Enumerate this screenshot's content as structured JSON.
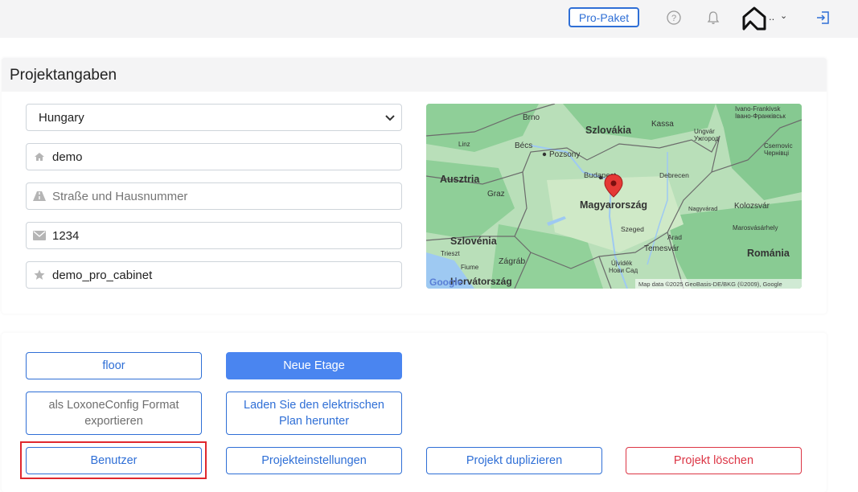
{
  "topbar": {
    "pro_label": "Pro-Paket",
    "user_dots": "..",
    "icons": [
      "help-icon",
      "bell-icon",
      "home-logo-icon",
      "chevron-down-icon",
      "logout-icon"
    ]
  },
  "project": {
    "title": "Projektangaben",
    "country": "Hungary",
    "name_value": "demo",
    "street_placeholder": "Straße und Hausnummer",
    "zip_value": "1234",
    "cabinet_value": "demo_pro_cabinet"
  },
  "map": {
    "labels": {
      "brno": "Brno",
      "slovakia": "Szlovákia",
      "kassa": "Kassa",
      "ungvar": "Ungvár",
      "uzhhorod": "Ужгород",
      "ivano": "Ivano-Frankivsk",
      "ivano_cyr": "Івано-Франківськ",
      "linz": "Linz",
      "becs": "Bécs",
      "pozsony": "Pozsony",
      "csernovic": "Csernovic",
      "chernivtsi": "Чернівці",
      "austria": "Ausztria",
      "budapest": "Budapest",
      "debrecen": "Debrecen",
      "graz": "Graz",
      "hungary": "Magyarország",
      "nagyvarad": "Nagyvárad",
      "kolozsvar": "Kolozsvár",
      "szeged": "Szeged",
      "arad": "Arad",
      "marosvasarhely": "Marosvásárhely",
      "slovenia": "Szlovénia",
      "temesvar": "Temesvár",
      "trieszt": "Trieszt",
      "zagrab": "Zágráb",
      "romania": "Románia",
      "fiume": "Fiume",
      "ujvidek": "Újvidék",
      "novi_sad": "Нови Сад",
      "croatia": "Horvátország",
      "google": "Google",
      "attribution": "Map data ©2025 GeoBasis-DE/BKG (©2009), Google"
    }
  },
  "actions": {
    "floor": "floor",
    "new_floor": "Neue Etage",
    "export_line1": "als LoxoneConfig Format",
    "export_line2": "exportieren",
    "download_line1": "Laden Sie den elektrischen",
    "download_line2": "Plan herunter",
    "users": "Benutzer",
    "settings": "Projekteinstellungen",
    "duplicate": "Projekt duplizieren",
    "delete": "Projekt löschen"
  },
  "colors": {
    "accent": "#2f6fd6",
    "primary_fill": "#4a85f0",
    "danger": "#dc3545",
    "highlight": "#e0282e",
    "topbar_bg": "#f4f4f5"
  }
}
